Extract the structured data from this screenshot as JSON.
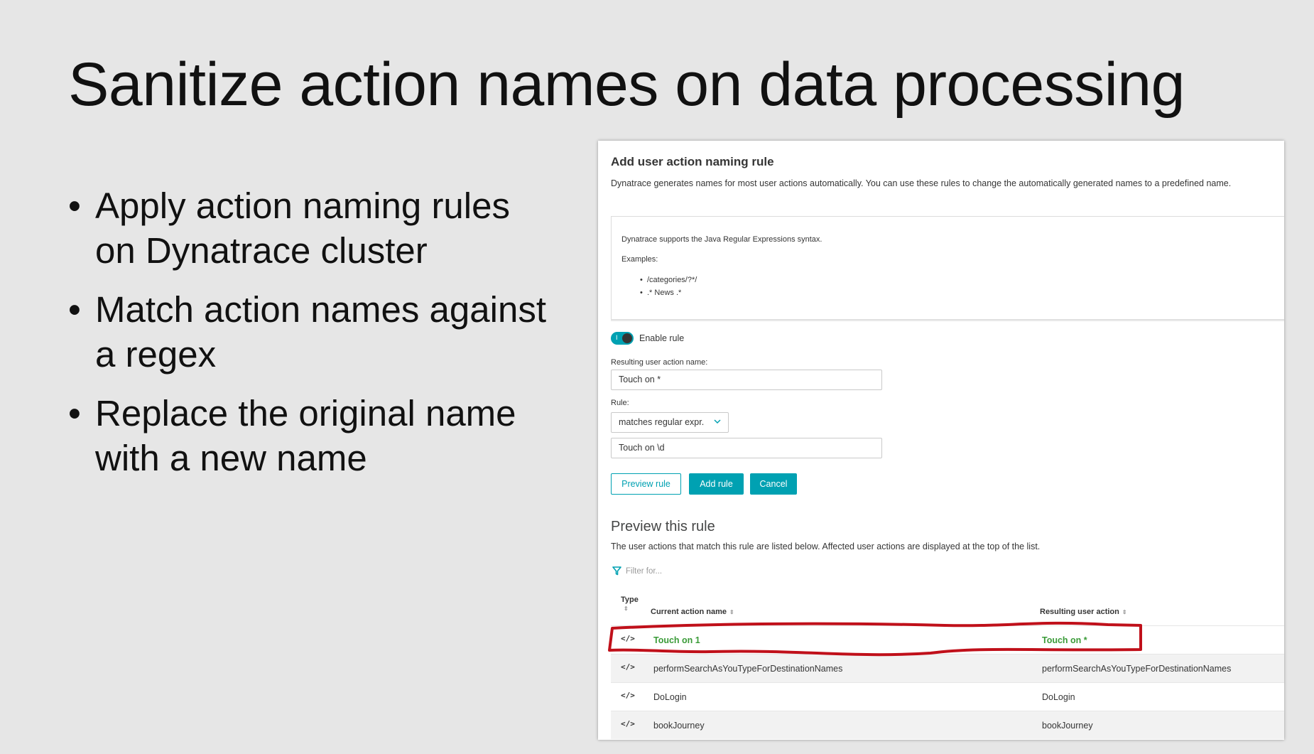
{
  "slide": {
    "title": "Sanitize action names on data processing",
    "bullets": [
      "Apply action naming rules on Dynatrace cluster",
      "Match action names against a regex",
      "Replace the original name with a new name"
    ]
  },
  "panel": {
    "title": "Add user action naming rule",
    "description": "Dynatrace generates names for most user actions automatically. You can use these rules to change the automatically generated names to a predefined name.",
    "info": {
      "text": "Dynatrace supports the Java Regular Expressions syntax.",
      "examples_label": "Examples:",
      "examples": [
        "/categories/?*/",
        ".* News .*"
      ]
    },
    "enable_rule_label": "Enable rule",
    "enable_rule_on": true,
    "resulting_name_label": "Resulting user action name:",
    "resulting_name_value": "Touch on *",
    "rule_label": "Rule:",
    "rule_select_value": "matches regular expr.",
    "rule_pattern_value": "Touch on \\d",
    "buttons": {
      "preview": "Preview rule",
      "add": "Add rule",
      "cancel": "Cancel"
    },
    "preview": {
      "title": "Preview this rule",
      "description": "The user actions that match this rule are listed below. Affected user actions are displayed at the top of the list.",
      "filter_placeholder": "Filter for...",
      "columns": {
        "type": "Type",
        "current": "Current action name",
        "resulting": "Resulting user action"
      },
      "rows": [
        {
          "type": "</>",
          "current": "Touch on 1",
          "resulting": "Touch on *"
        },
        {
          "type": "</>",
          "current": "performSearchAsYouTypeForDestinationNames",
          "resulting": "performSearchAsYouTypeForDestinationNames"
        },
        {
          "type": "</>",
          "current": "DoLogin",
          "resulting": "DoLogin"
        },
        {
          "type": "</>",
          "current": "bookJourney",
          "resulting": "bookJourney"
        }
      ]
    }
  },
  "colors": {
    "accent": "#00a1b2",
    "match_green": "#3a9b38",
    "annotation_red": "#c0101a",
    "slide_bg": "#e6e6e6"
  }
}
